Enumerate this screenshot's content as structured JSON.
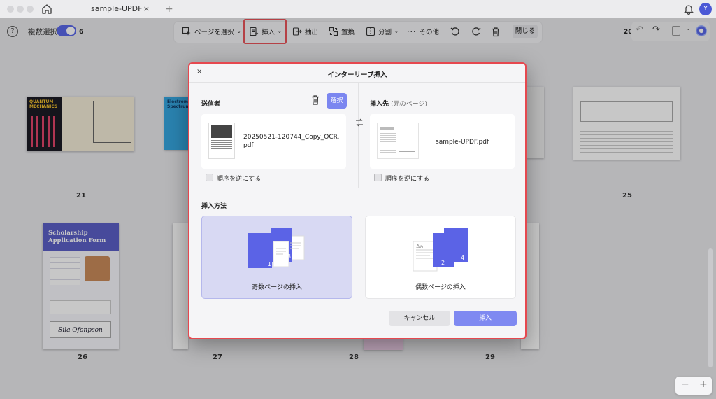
{
  "app": {
    "tab_title": "sample-UPDF",
    "tab_close": "×",
    "tab_add": "+",
    "user_initial": "Y"
  },
  "toolbar": {
    "help": "?",
    "multi_select_label": "複数選択",
    "page_left": "6",
    "page_right": "20",
    "tools": {
      "select_pages": "ページを選択",
      "insert": "挿入",
      "extract": "抽出",
      "replace": "置換",
      "split": "分割",
      "other": "その他"
    },
    "close_label": "閉じる"
  },
  "thumbnails": {
    "page_labels": [
      "21",
      "25",
      "26",
      "27",
      "28",
      "29"
    ],
    "quantum_title": "QUANTUM MECHANICS",
    "spectrum_title": "Electromagnetic Spectrum",
    "scholarship_title": "Scholarship Application Form",
    "scholarship_signature": "Sila Ofonpson"
  },
  "dialog": {
    "close": "×",
    "title": "インターリーブ挿入",
    "sender_label": "送信者",
    "select_button": "選択",
    "sender_file": "20250521-120744_Copy_OCR.pdf",
    "target_label": "挿入先",
    "target_sublabel": "(元のページ)",
    "target_file": "sample-UPDF.pdf",
    "reverse_label": "順序を逆にする",
    "method_label": "挿入方法",
    "method_odd": "奇数ページの挿入",
    "method_even": "偶数ページの挿入",
    "odd_nums": [
      "1",
      "3"
    ],
    "even_nums": [
      "2",
      "4"
    ],
    "cancel": "キャンセル",
    "insert": "挿入"
  },
  "zoom": {
    "minus": "−",
    "plus": "+"
  },
  "colors": {
    "accent": "#5a68e8",
    "highlight": "#e6484f",
    "card_purple": "#5b63e6"
  }
}
